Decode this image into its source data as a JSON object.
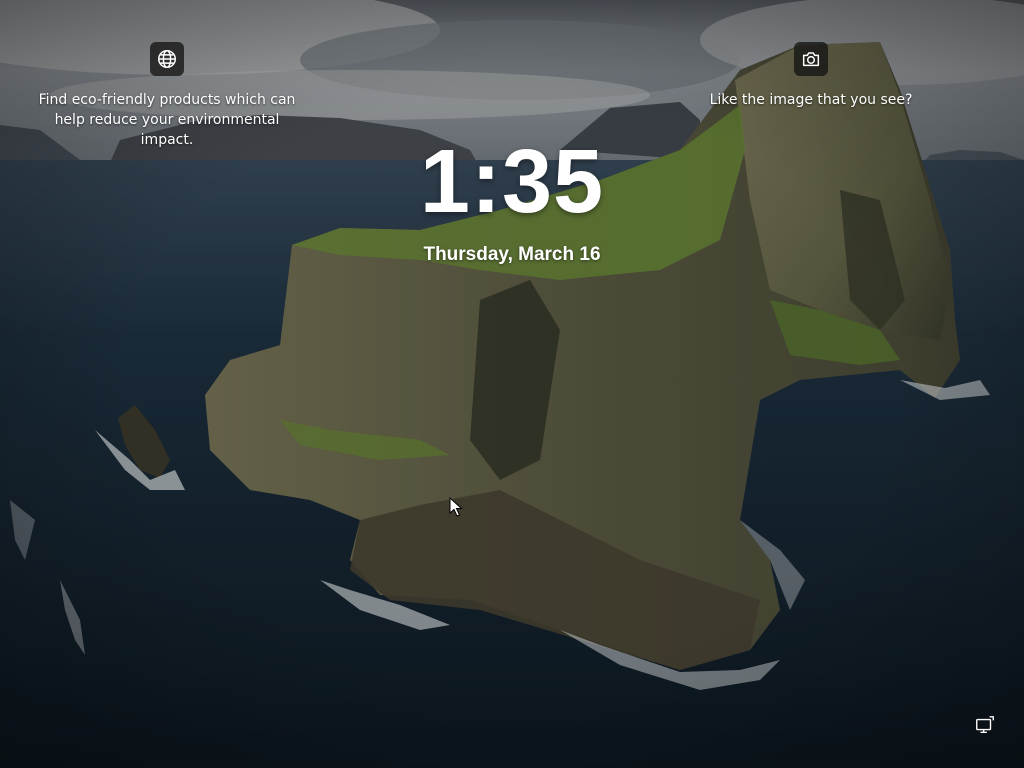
{
  "lockscreen": {
    "time": "1:35",
    "date": "Thursday, March 16"
  },
  "tips": {
    "left": {
      "icon": "globe-icon",
      "text": "Find eco-friendly products which can help reduce your environmental impact."
    },
    "right": {
      "icon": "camera-icon",
      "text": "Like the image that you see?"
    }
  },
  "status": {
    "network_icon": "network-icon"
  },
  "colors": {
    "sea_dark": "#15222c",
    "sky": "#8d949c",
    "cliff": "#6b6a4c",
    "grass": "#6e8f3a",
    "text": "#ffffff",
    "icon_bg": "#1b1b1b"
  }
}
